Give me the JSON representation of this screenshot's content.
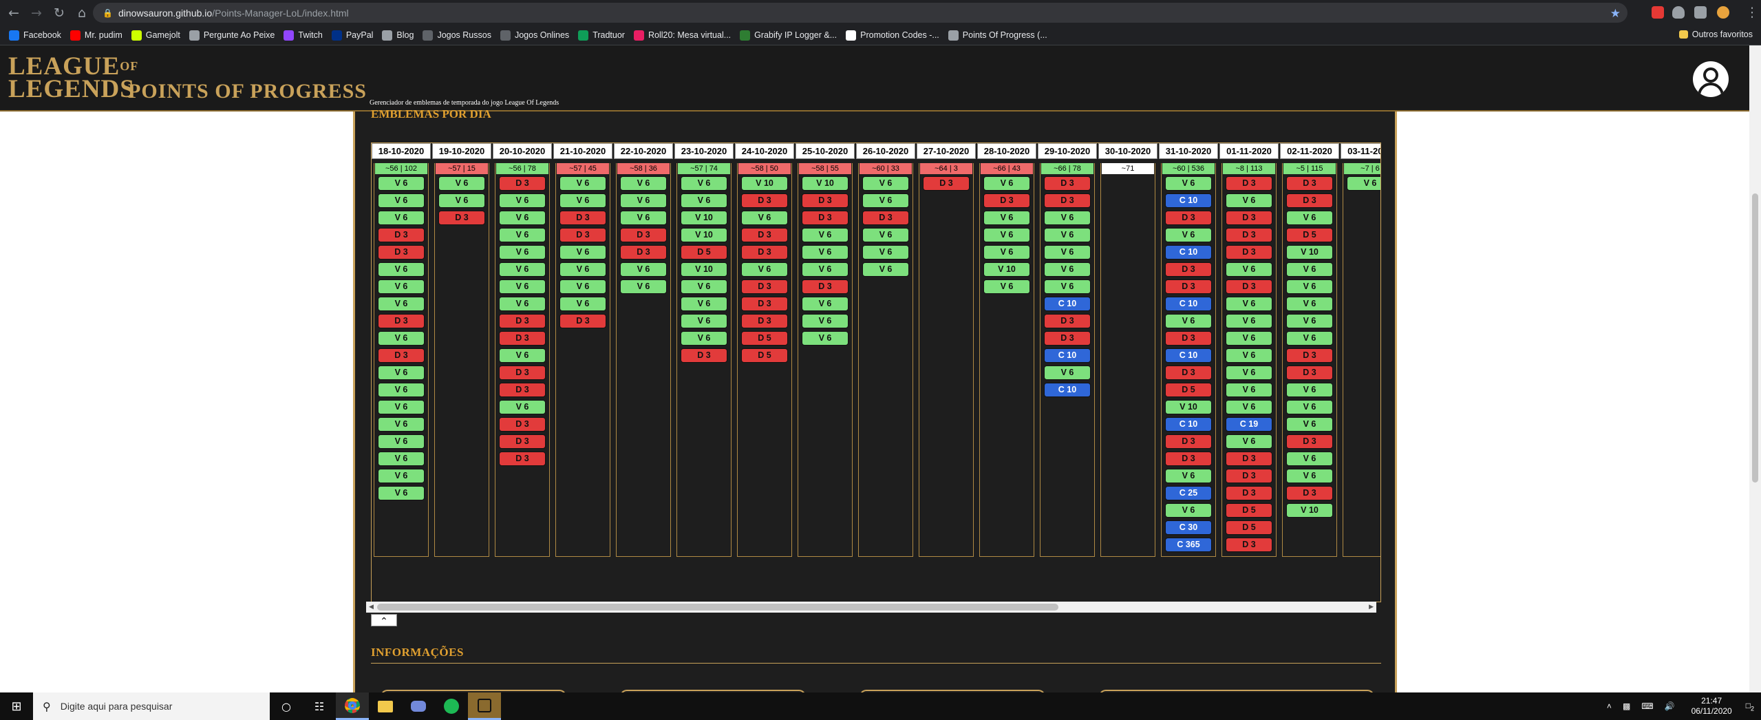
{
  "browser": {
    "url_host": "dinowsauron.github.io",
    "url_path": "/Points-Manager-LoL/index.html",
    "bookmarks": [
      {
        "label": "Facebook",
        "icon": "facebook-icon",
        "color": "#1877f2"
      },
      {
        "label": "Mr. pudim",
        "icon": "youtube-icon",
        "color": "#ff0000"
      },
      {
        "label": "Gamejolt",
        "icon": "gamejolt-icon",
        "color": "#ccff00"
      },
      {
        "label": "Pergunte Ao Peixe",
        "icon": "globe-icon",
        "color": "#9aa0a6"
      },
      {
        "label": "Twitch",
        "icon": "twitch-icon",
        "color": "#9146ff"
      },
      {
        "label": "PayPal",
        "icon": "paypal-icon",
        "color": "#003087"
      },
      {
        "label": "Blog",
        "icon": "blog-icon",
        "color": "#9aa0a6"
      },
      {
        "label": "Jogos Russos",
        "icon": "vt-icon",
        "color": "#5f6368"
      },
      {
        "label": "Jogos Onlines",
        "icon": "dots-icon",
        "color": "#5f6368"
      },
      {
        "label": "Tradtuor",
        "icon": "translator-icon",
        "color": "#0f9d58"
      },
      {
        "label": "Roll20: Mesa virtual...",
        "icon": "roll20-icon",
        "color": "#e91e63"
      },
      {
        "label": "Grabify IP Logger &...",
        "icon": "grabify-icon",
        "color": "#2e7d32"
      },
      {
        "label": "Promotion Codes -...",
        "icon": "star-icon",
        "color": "#ffffff"
      },
      {
        "label": "Points Of Progress (...",
        "icon": "page-icon",
        "color": "#9aa0a6"
      }
    ],
    "other_bookmarks": "Outros favoritos"
  },
  "site": {
    "logo_top": "LEAGUE",
    "logo_of": "OF",
    "logo_bottom": "LEGENDS",
    "logo_sub": "POINTS OF PROGRESS",
    "tagline": "Gerenciador de emblemas de temporada do jogo League Of Legends"
  },
  "section": {
    "title": "EMBLEMAS POR DIA",
    "info_title": "INFORMAÇÕES"
  },
  "days": [
    {
      "date": "18-10-2020",
      "summary": "~56 | 102",
      "sum_color": "green",
      "chips": [
        "V 6",
        "V 6",
        "V 6",
        "D 3",
        "D 3",
        "V 6",
        "V 6",
        "V 6",
        "D 3",
        "V 6",
        "D 3",
        "V 6",
        "V 6",
        "V 6",
        "V 6",
        "V 6",
        "V 6",
        "V 6",
        "V 6"
      ]
    },
    {
      "date": "19-10-2020",
      "summary": "~57 | 15",
      "sum_color": "red",
      "chips": [
        "V 6",
        "V 6",
        "D 3"
      ]
    },
    {
      "date": "20-10-2020",
      "summary": "~56 | 78",
      "sum_color": "green",
      "chips": [
        "D 3",
        "V 6",
        "V 6",
        "V 6",
        "V 6",
        "V 6",
        "V 6",
        "V 6",
        "D 3",
        "D 3",
        "V 6",
        "D 3",
        "D 3",
        "V 6",
        "D 3",
        "D 3",
        "D 3"
      ]
    },
    {
      "date": "21-10-2020",
      "summary": "~57 | 45",
      "sum_color": "red",
      "chips": [
        "V 6",
        "V 6",
        "D 3",
        "D 3",
        "V 6",
        "V 6",
        "V 6",
        "V 6",
        "D 3"
      ]
    },
    {
      "date": "22-10-2020",
      "summary": "~58 | 36",
      "sum_color": "red",
      "chips": [
        "V 6",
        "V 6",
        "V 6",
        "D 3",
        "D 3",
        "V 6",
        "V 6"
      ]
    },
    {
      "date": "23-10-2020",
      "summary": "~57 | 74",
      "sum_color": "green",
      "chips": [
        "V 6",
        "V 6",
        "V 10",
        "V 10",
        "D 5",
        "V 10",
        "V 6",
        "V 6",
        "V 6",
        "V 6",
        "D 3"
      ]
    },
    {
      "date": "24-10-2020",
      "summary": "~58 | 50",
      "sum_color": "red",
      "chips": [
        "V 10",
        "D 3",
        "V 6",
        "D 3",
        "D 3",
        "V 6",
        "D 3",
        "D 3",
        "D 3",
        "D 5",
        "D 5"
      ]
    },
    {
      "date": "25-10-2020",
      "summary": "~58 | 55",
      "sum_color": "red",
      "chips": [
        "V 10",
        "D 3",
        "D 3",
        "V 6",
        "V 6",
        "V 6",
        "D 3",
        "V 6",
        "V 6",
        "V 6"
      ]
    },
    {
      "date": "26-10-2020",
      "summary": "~60 | 33",
      "sum_color": "red",
      "chips": [
        "V 6",
        "V 6",
        "D 3",
        "V 6",
        "V 6",
        "V 6"
      ]
    },
    {
      "date": "27-10-2020",
      "summary": "~64 | 3",
      "sum_color": "red",
      "chips": [
        "D 3"
      ]
    },
    {
      "date": "28-10-2020",
      "summary": "~66 | 43",
      "sum_color": "red",
      "chips": [
        "V 6",
        "D 3",
        "V 6",
        "V 6",
        "V 6",
        "V 10",
        "V 6"
      ]
    },
    {
      "date": "29-10-2020",
      "summary": "~66 | 78",
      "sum_color": "green",
      "chips": [
        "D 3",
        "D 3",
        "V 6",
        "V 6",
        "V 6",
        "V 6",
        "V 6",
        "C 10",
        "D 3",
        "D 3",
        "C 10",
        "V 6",
        "C 10"
      ]
    },
    {
      "date": "30-10-2020",
      "summary": "~71",
      "sum_color": "white",
      "chips": []
    },
    {
      "date": "31-10-2020",
      "summary": "~60 | 536",
      "sum_color": "green",
      "chips": [
        "V 6",
        "C 10",
        "D 3",
        "V 6",
        "C 10",
        "D 3",
        "D 3",
        "C 10",
        "V 6",
        "D 3",
        "C 10",
        "D 3",
        "D 5",
        "V 10",
        "C 10",
        "D 3",
        "D 3",
        "V 6",
        "C 25",
        "V 6",
        "C 30",
        "C 365"
      ]
    },
    {
      "date": "01-11-2020",
      "summary": "~8 | 113",
      "sum_color": "green",
      "chips": [
        "D 3",
        "V 6",
        "D 3",
        "D 3",
        "D 3",
        "V 6",
        "D 3",
        "V 6",
        "V 6",
        "V 6",
        "V 6",
        "V 6",
        "V 6",
        "V 6",
        "C 19",
        "V 6",
        "D 3",
        "D 3",
        "D 3",
        "D 5",
        "D 5",
        "D 3"
      ]
    },
    {
      "date": "02-11-2020",
      "summary": "~5 | 115",
      "sum_color": "green",
      "chips": [
        "D 3",
        "D 3",
        "V 6",
        "D 5",
        "V 10",
        "V 6",
        "V 6",
        "V 6",
        "V 6",
        "V 6",
        "D 3",
        "D 3",
        "V 6",
        "V 6",
        "V 6",
        "D 3",
        "V 6",
        "V 6",
        "D 3",
        "V 10"
      ]
    },
    {
      "date": "03-11-2020",
      "summary": "~7 | 6",
      "sum_color": "green",
      "chips": [
        "V 6"
      ]
    }
  ],
  "taskbar": {
    "search_placeholder": "Digite aqui para pesquisar",
    "time": "21:47",
    "date": "06/11/2020",
    "notifications": "2"
  }
}
